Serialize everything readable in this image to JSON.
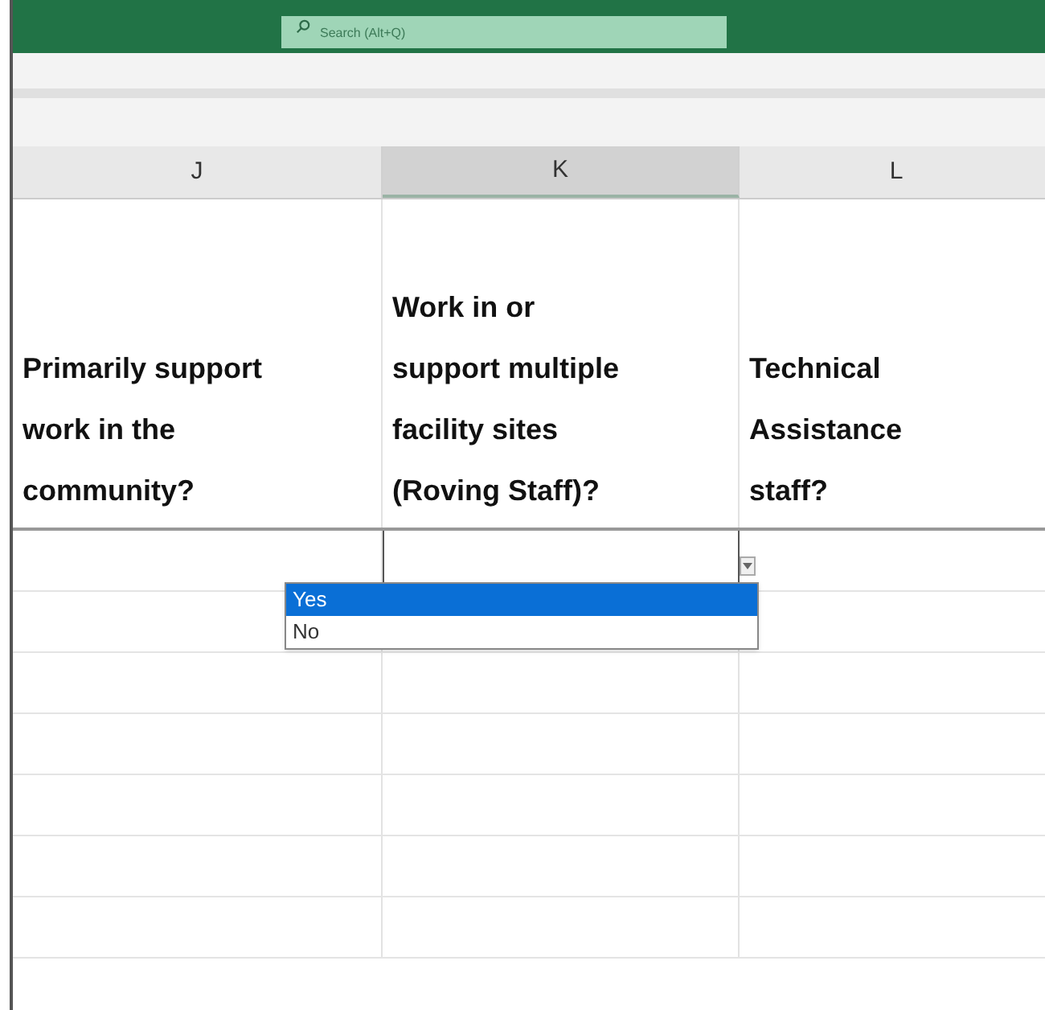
{
  "title_bar": {
    "search": {
      "placeholder": "Search (Alt+Q)"
    }
  },
  "columns": [
    {
      "letter": "J",
      "selected": false,
      "header": "Primarily support work in the community?"
    },
    {
      "letter": "K",
      "selected": true,
      "header": "Work in or support multiple facility sites (Roving Staff)?"
    },
    {
      "letter": "L",
      "selected": false,
      "header": "Technical Assistance staff?"
    }
  ],
  "dropdown": {
    "options": [
      {
        "label": "Yes",
        "selected": true
      },
      {
        "label": "No",
        "selected": false
      }
    ]
  }
}
